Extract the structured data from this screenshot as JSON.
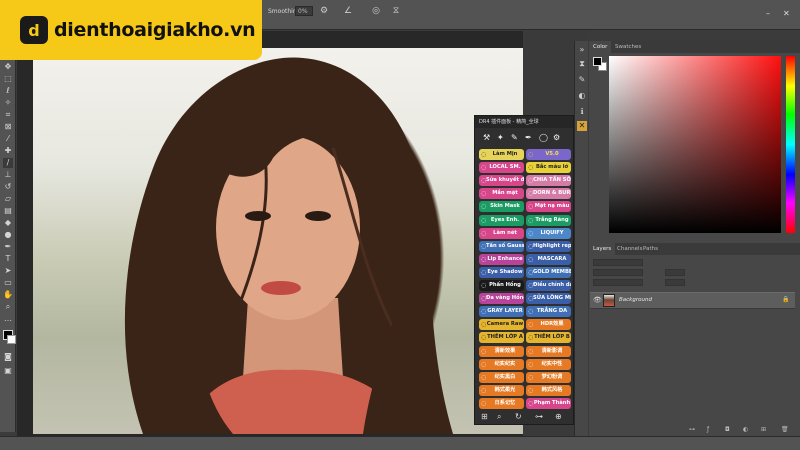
{
  "logo": {
    "mark": "d",
    "text": "dienthoaigiakho.vn"
  },
  "options": {
    "smoothing_label": "Smoothing:",
    "smoothing_value": "0%"
  },
  "color_panel": {
    "tabs": [
      "Color",
      "Swatches"
    ],
    "foreground": "#000000",
    "background": "#ffffff"
  },
  "layers_panel": {
    "tabs": [
      "Layers",
      "Channels",
      "Paths"
    ],
    "layer_name": "Background"
  },
  "plugin": {
    "title": "DR4 插件面板 - 精简_全球",
    "buttons": [
      {
        "label": "Làm Mịn",
        "color": "#e6d35a",
        "tc": "#222"
      },
      {
        "label": "V5.0",
        "color": "#7a67c9",
        "tc": "#f5e14a"
      },
      {
        "label": "LOCAL SM.",
        "color": "#d7458a",
        "tc": "#fff"
      },
      {
        "label": "Bắc màu lớ",
        "color": "#e7d038",
        "tc": "#222"
      },
      {
        "label": "Sửa khuyết điểm",
        "color": "#d7458a",
        "tc": "#fff"
      },
      {
        "label": "CHIA TẦN SỐ",
        "color": "#d67aa8",
        "tc": "#fff"
      },
      {
        "label": "Mắn mặt",
        "color": "#d7458a",
        "tc": "#fff"
      },
      {
        "label": "DORN & BURN",
        "color": "#d67aa8",
        "tc": "#fff"
      },
      {
        "label": "Skin Mask",
        "color": "#1a9c64",
        "tc": "#fff"
      },
      {
        "label": "Mặt nạ màu",
        "color": "#d7458a",
        "tc": "#fff"
      },
      {
        "label": "Eyes Enh.",
        "color": "#1a9c64",
        "tc": "#fff"
      },
      {
        "label": "Trắng Răng",
        "color": "#1a9c64",
        "tc": "#fff"
      },
      {
        "label": "Làm nét",
        "color": "#d7458a",
        "tc": "#fff"
      },
      {
        "label": "LIQUIFY",
        "color": "#4b87c9",
        "tc": "#fff"
      },
      {
        "label": "Tần số Gauss",
        "color": "#3f6fb5",
        "tc": "#fff"
      },
      {
        "label": "Highlight repair",
        "color": "#3a5fa8",
        "tc": "#fff"
      },
      {
        "label": "Lip Enhance",
        "color": "#b8439b",
        "tc": "#fff"
      },
      {
        "label": "MASCARA",
        "color": "#3a5fa8",
        "tc": "#fff"
      },
      {
        "label": "Eye Shadow",
        "color": "#3a5fa8",
        "tc": "#fff"
      },
      {
        "label": "GOLD MEMBER",
        "color": "#3f6fb5",
        "tc": "#fff"
      },
      {
        "label": "Phấn Hồng",
        "color": "#1a1a1a",
        "tc": "#fff"
      },
      {
        "label": "Điều chỉnh da",
        "color": "#3a5fa8",
        "tc": "#fff"
      },
      {
        "label": "Đa vàng Hồng",
        "color": "#b8439b",
        "tc": "#fff"
      },
      {
        "label": "SỬA LÔNG MI",
        "color": "#3a5fa8",
        "tc": "#fff"
      },
      {
        "label": "GRAY LAYER",
        "color": "#3f6fb5",
        "tc": "#fff"
      },
      {
        "label": "TRẮNG DA",
        "color": "#3f6fb5",
        "tc": "#fff"
      },
      {
        "label": "Camera Raw",
        "color": "#e6b52e",
        "tc": "#222"
      },
      {
        "label": "HDR效果",
        "color": "#e67a24",
        "tc": "#fff"
      },
      {
        "label": "THÊM LỚP A",
        "color": "#e6b52e",
        "tc": "#222"
      },
      {
        "label": "THÊM LỚP B",
        "color": "#e6b52e",
        "tc": "#222"
      },
      {
        "label": "清新效果",
        "color": "#e67a24",
        "tc": "#fff"
      },
      {
        "label": "清新影调",
        "color": "#e67a24",
        "tc": "#fff"
      },
      {
        "label": "纪实纪实",
        "color": "#e67a24",
        "tc": "#fff"
      },
      {
        "label": "纪实中性",
        "color": "#e67a24",
        "tc": "#fff"
      },
      {
        "label": "纪实黑白",
        "color": "#e67a24",
        "tc": "#fff"
      },
      {
        "label": "梦幻粉调",
        "color": "#e67a24",
        "tc": "#fff"
      },
      {
        "label": "韩式柔光",
        "color": "#e67a24",
        "tc": "#fff"
      },
      {
        "label": "韩式风格",
        "color": "#e67a24",
        "tc": "#fff"
      },
      {
        "label": "日系记忆",
        "color": "#e67a24",
        "tc": "#fff"
      },
      {
        "label": "Phạm Thành",
        "color": "#d7458a",
        "tc": "#fff"
      }
    ]
  }
}
